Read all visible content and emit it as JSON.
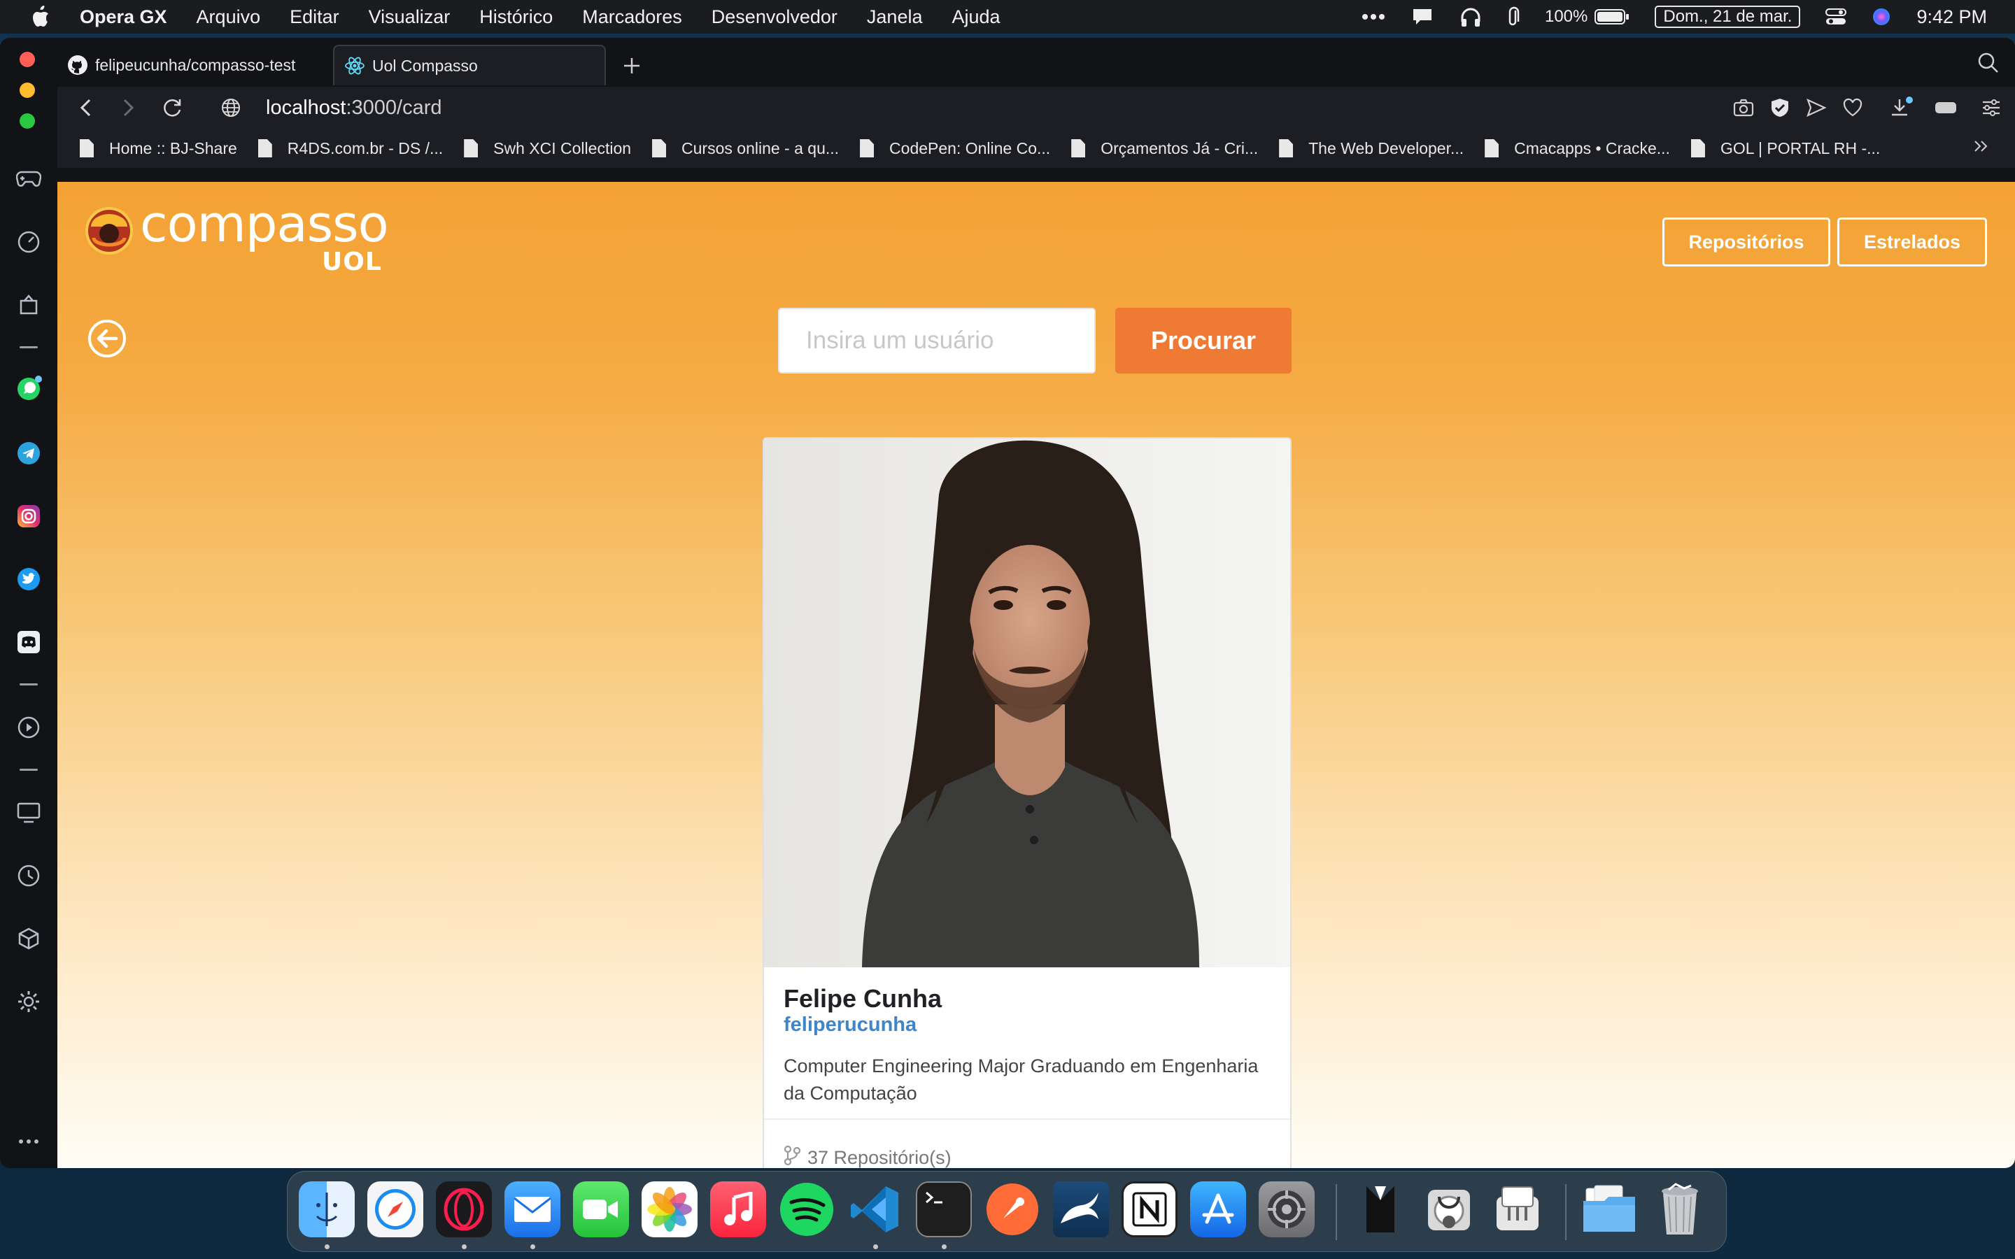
{
  "menubar": {
    "app": "Opera GX",
    "items": [
      "Arquivo",
      "Editar",
      "Visualizar",
      "Histórico",
      "Marcadores",
      "Desenvolvedor",
      "Janela",
      "Ajuda"
    ],
    "battery": "100%",
    "date": "Dom., 21 de mar.",
    "time": "9:42 PM"
  },
  "tabs": [
    {
      "label": "felipeucunha/compasso-test",
      "icon": "github-icon"
    },
    {
      "label": "Uol Compasso",
      "icon": "react-icon",
      "active": true
    }
  ],
  "address": {
    "host": "localhost",
    "path": ":3000/card"
  },
  "bookmarks": [
    "Home :: BJ-Share",
    "R4DS.com.br - DS /...",
    "Swh XCI Collection",
    "Cursos online - a qu...",
    "CodePen: Online Co...",
    "Orçamentos Já - Cri...",
    "The Web Developer...",
    "Cmacapps • Cracke...",
    "GOL | PORTAL RH -..."
  ],
  "page": {
    "logo_text": "compasso",
    "logo_sub": "UOL",
    "nav_repos": "Repositórios",
    "nav_starred": "Estrelados",
    "search_placeholder": "Insira um usuário",
    "search_button": "Procurar",
    "accent": "#ef7a34",
    "background_top": "#f4a234"
  },
  "card": {
    "name": "Felipe Cunha",
    "login": "feliperucunha",
    "bio": "Computer Engineering Major Graduando em Engenharia da Computação",
    "repos": "37 Repositório(s)"
  },
  "dock": {
    "apps": [
      "Finder",
      "Safari",
      "Opera GX",
      "Mail",
      "FaceTime",
      "Photos",
      "Music",
      "Spotify",
      "Visual Studio Code",
      "Terminal",
      "Postman",
      "MySQL Workbench",
      "Notion",
      "App Store",
      "System Preferences",
      "Bartender",
      "Disk Utility",
      "System Information",
      "Downloads",
      "Trash"
    ]
  }
}
